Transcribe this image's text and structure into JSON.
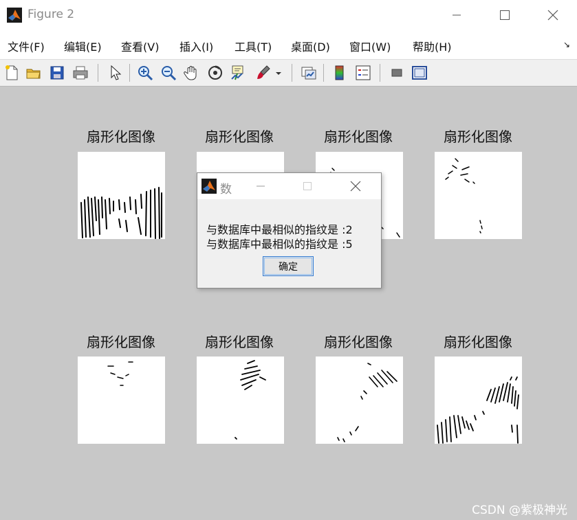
{
  "window": {
    "title": "Figure 2"
  },
  "menu": [
    "文件(F)",
    "编辑(E)",
    "查看(V)",
    "插入(I)",
    "工具(T)",
    "桌面(D)",
    "窗口(W)",
    "帮助(H)"
  ],
  "toolbar_icons": [
    "new-figure-icon",
    "open-folder-icon",
    "save-icon",
    "print-icon",
    "pointer-icon",
    "zoom-in-icon",
    "zoom-out-icon",
    "pan-hand-icon",
    "rotate-3d-icon",
    "data-cursor-icon",
    "brush-icon",
    "brush-dropdown-icon",
    "link-plot-icon",
    "colorbar-icon",
    "legend-icon",
    "hide-plot-tools-icon",
    "show-plot-tools-icon"
  ],
  "subplots": [
    {
      "title": "扇形化图像"
    },
    {
      "title": "扇形化图像"
    },
    {
      "title": "扇形化图像"
    },
    {
      "title": "扇形化图像"
    },
    {
      "title": "扇形化图像"
    },
    {
      "title": "扇形化图像"
    },
    {
      "title": "扇形化图像"
    },
    {
      "title": "扇形化图像"
    }
  ],
  "dialog": {
    "title": "数",
    "lines": [
      "与数据库中最相似的指纹是 :2",
      "与数据库中最相似的指纹是 :5"
    ],
    "ok_label": "确定"
  },
  "watermark": "CSDN @紫极神光"
}
